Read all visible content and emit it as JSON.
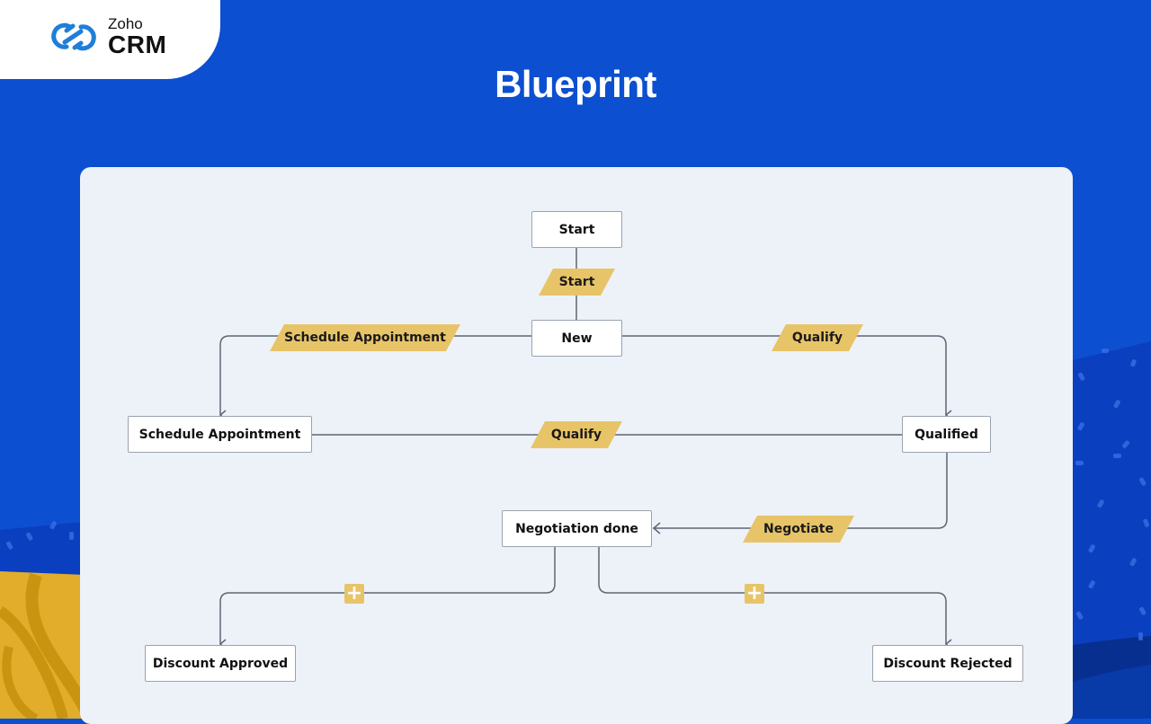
{
  "brand": {
    "logo_icon": "zoho-rings-icon",
    "logo_top": "Zoho",
    "logo_bottom": "CRM"
  },
  "header": {
    "title": "Blueprint"
  },
  "colors": {
    "background_blue": "#0c4fd0",
    "canvas": "#edf2f9",
    "transition": "#e8c468",
    "connector": "#5d6673",
    "logo_blue": "#1f7fd8",
    "accent_yellow": "#e2ad2a"
  },
  "blueprint": {
    "states": [
      {
        "id": "start",
        "label": "Start"
      },
      {
        "id": "new",
        "label": "New"
      },
      {
        "id": "schedule_appointment",
        "label": "Schedule Appointment"
      },
      {
        "id": "qualified",
        "label": "Qualified"
      },
      {
        "id": "negotiation_done",
        "label": "Negotiation done"
      },
      {
        "id": "discount_approved",
        "label": "Discount Approved"
      },
      {
        "id": "discount_rejected",
        "label": "Discount Rejected"
      }
    ],
    "transitions": [
      {
        "label": "Start",
        "from": "start",
        "to": "new"
      },
      {
        "label": "Schedule Appointment",
        "from": "new",
        "to": "schedule_appointment"
      },
      {
        "label": "Qualify",
        "from": "new",
        "to": "qualified"
      },
      {
        "label": "Qualify",
        "from": "schedule_appointment",
        "to": "qualified"
      },
      {
        "label": "Negotiate",
        "from": "qualified",
        "to": "negotiation_done"
      }
    ],
    "add_transition_buttons": [
      {
        "icon": "plus-icon",
        "symbol": "+",
        "from": "negotiation_done",
        "to": "discount_approved"
      },
      {
        "icon": "plus-icon",
        "symbol": "+",
        "from": "negotiation_done",
        "to": "discount_rejected"
      }
    ]
  }
}
